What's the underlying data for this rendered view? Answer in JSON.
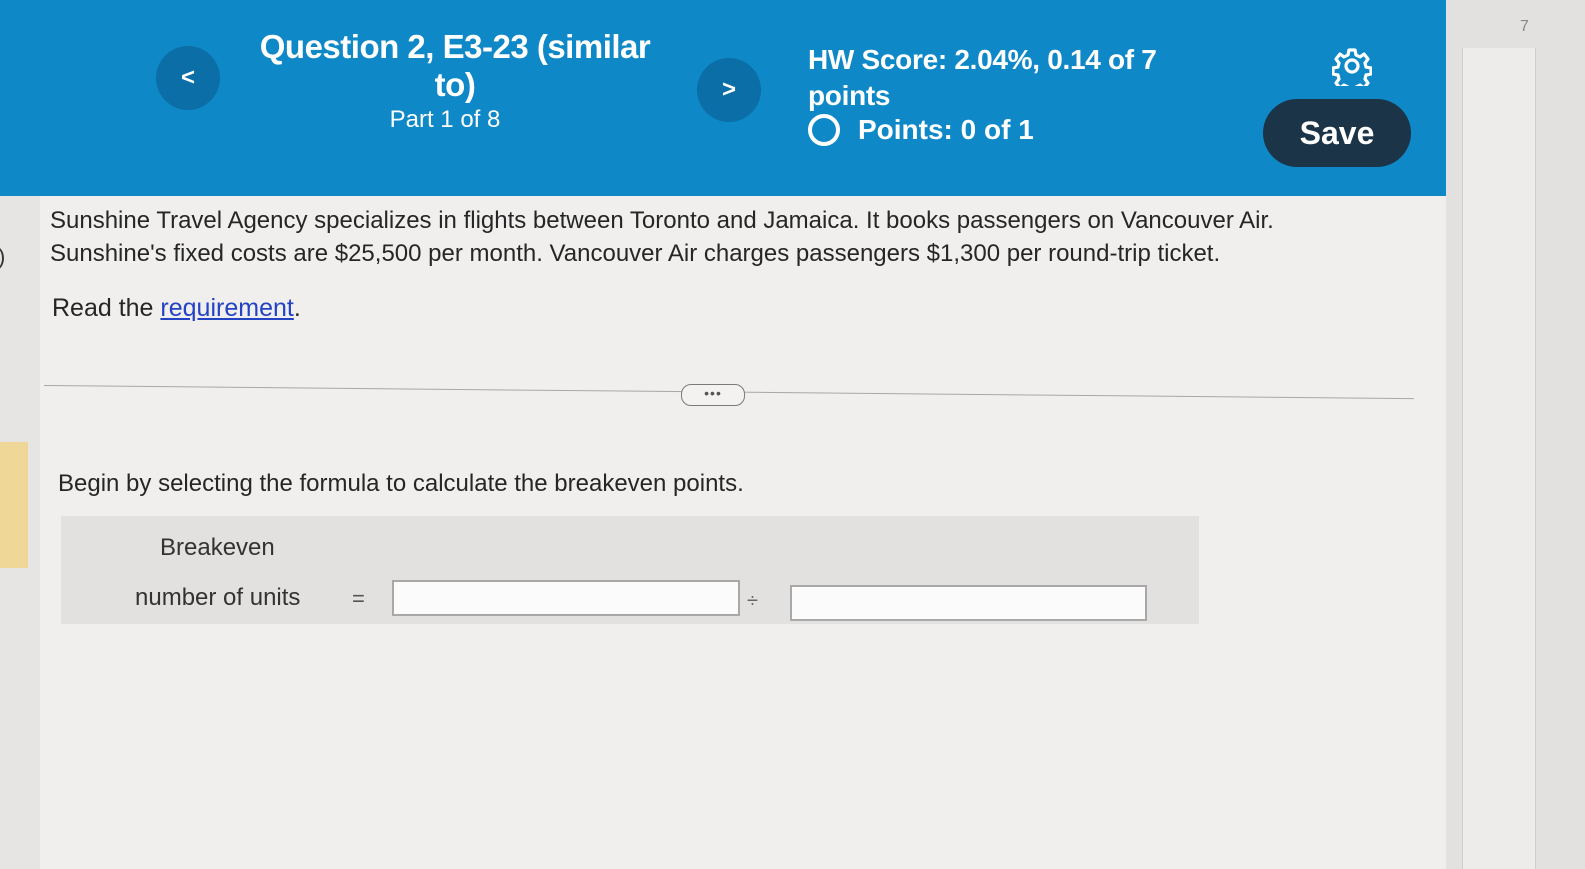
{
  "header": {
    "question_title": "Question 2, E3-23 (similar to)",
    "part": "Part 1 of 8",
    "hw_score": "HW Score: 2.04%, 0.14 of 7 points",
    "points": "Points: 0 of 1",
    "save_label": "Save",
    "prev_label": "<",
    "next_label": ">"
  },
  "side": {
    "right_number": "7"
  },
  "problem": {
    "text": "Sunshine Travel Agency specializes in flights between Toronto and Jamaica. It books passengers on Vancouver Air. Sunshine's fixed costs are $25,500 per month. Vancouver Air charges passengers $1,300 per round-trip ticket.",
    "read_prefix": "Read the ",
    "read_link": "requirement",
    "read_suffix": "."
  },
  "expand_label": "•••",
  "instruction": "Begin by selecting the formula to calculate the breakeven points.",
  "formula": {
    "label_line1": "Breakeven",
    "label_line2": "number of units",
    "equals": "=",
    "operator": "÷",
    "numerator_value": "",
    "denominator_value": ""
  },
  "colors": {
    "header_bg": "#0f88c7",
    "save_bg": "#1b3447",
    "link": "#2342c4"
  }
}
